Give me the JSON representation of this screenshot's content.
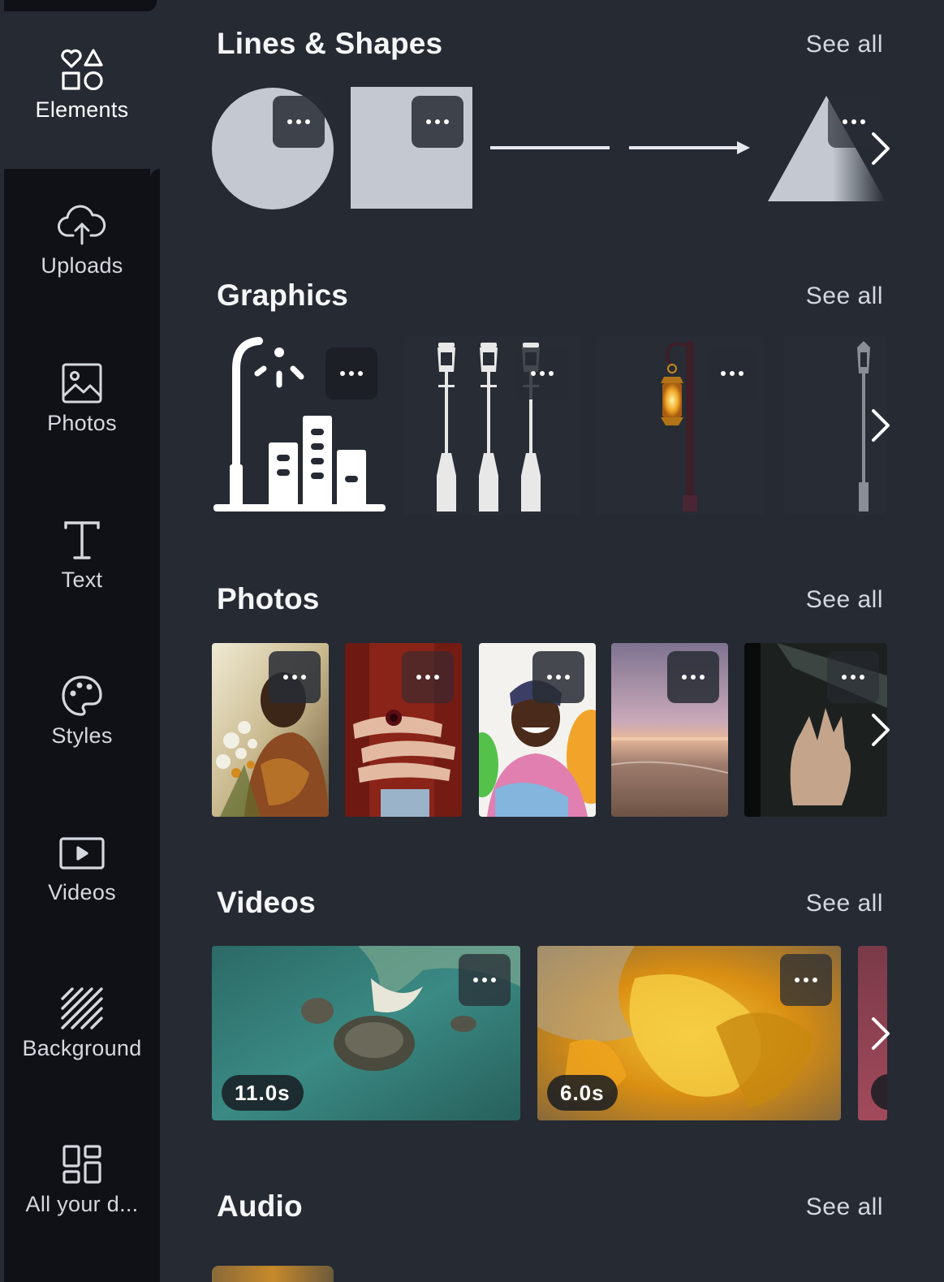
{
  "sidebar": {
    "items": [
      {
        "label": "Elements",
        "icon": "elements-icon",
        "active": true
      },
      {
        "label": "Uploads",
        "icon": "cloud-upload-icon"
      },
      {
        "label": "Photos",
        "icon": "image-icon"
      },
      {
        "label": "Text",
        "icon": "text-t-icon"
      },
      {
        "label": "Styles",
        "icon": "palette-icon"
      },
      {
        "label": "Videos",
        "icon": "video-play-icon"
      },
      {
        "label": "Background",
        "icon": "hatch-pattern-icon"
      },
      {
        "label": "All your d...",
        "icon": "grid-apps-icon"
      }
    ]
  },
  "sections": {
    "lines_shapes": {
      "title": "Lines & Shapes",
      "see_all": "See all"
    },
    "graphics": {
      "title": "Graphics",
      "see_all": "See all"
    },
    "photos": {
      "title": "Photos",
      "see_all": "See all"
    },
    "videos": {
      "title": "Videos",
      "see_all": "See all",
      "durations": [
        "11.0s",
        "6.0s"
      ]
    },
    "audio": {
      "title": "Audio",
      "see_all": "See all"
    }
  },
  "colors": {
    "panel_bg": "#252a33",
    "sidebar_bg": "#0f1116",
    "shape_fill": "#c3c8d1"
  }
}
